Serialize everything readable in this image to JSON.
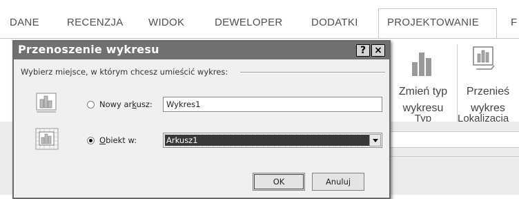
{
  "tabs": {
    "dane": "DANE",
    "recenzja": "RECENZJA",
    "widok": "WIDOK",
    "deweloper": "DEWELOPER",
    "dodatki": "DODATKI",
    "projektowanie": "PROJEKTOWANIE",
    "f": "F"
  },
  "ribbon": {
    "change_type_line1": "Zmień typ",
    "change_type_line2": "wykresu",
    "move_line1": "Przenieś",
    "move_line2": "wykres",
    "group_type": "Typ",
    "group_location": "Lokalizacja"
  },
  "dialog": {
    "title": "Przenoszenie wykresu",
    "help_btn": "?",
    "close_btn": "×",
    "group_label": "Wybierz miejsce, w którym chcesz umieścić wykres:",
    "new_sheet": {
      "label_pre": "Nowy ar",
      "label_u": "k",
      "label_post": "usz:",
      "value": "Wykres1",
      "selected": false
    },
    "object_in": {
      "label_u": "O",
      "label_post": "biekt w:",
      "value": "Arkusz1",
      "selected": true
    },
    "ok": "OK",
    "cancel": "Anuluj"
  },
  "icons": [
    "chart-new-sheet-icon",
    "chart-embedded-icon",
    "change-chart-type-icon",
    "move-chart-icon"
  ]
}
